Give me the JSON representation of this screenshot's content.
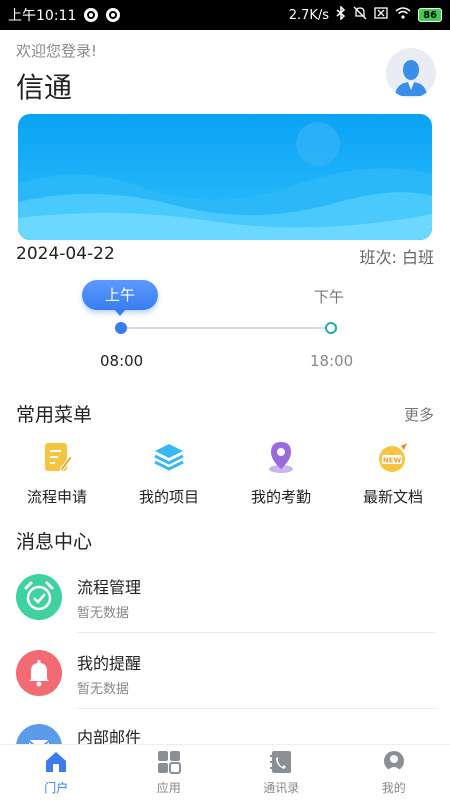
{
  "status_bar": {
    "time": "上午10:11",
    "network_speed": "2.7K/s",
    "battery": "86"
  },
  "header": {
    "welcome": "欢迎您登录!",
    "title": "信通"
  },
  "schedule": {
    "date": "2024-04-22",
    "shift_label": "班次:",
    "shift_value": "白班",
    "am_label": "上午",
    "pm_label": "下午",
    "am_time": "08:00",
    "pm_time": "18:00"
  },
  "common_menu": {
    "title": "常用菜单",
    "more": "更多",
    "items": [
      {
        "label": "流程申请",
        "icon": "document-edit-icon",
        "color": "#f5c542"
      },
      {
        "label": "我的项目",
        "icon": "layers-icon",
        "color": "#39b8ef"
      },
      {
        "label": "我的考勤",
        "icon": "location-pin-icon",
        "color": "#9b6bdc"
      },
      {
        "label": "最新文档",
        "icon": "new-badge-icon",
        "color": "#f5c542"
      }
    ]
  },
  "messages": {
    "title": "消息中心",
    "items": [
      {
        "title": "流程管理",
        "subtitle": "暂无数据",
        "icon": "alarm-clock-icon",
        "color": "#3fd1a0"
      },
      {
        "title": "我的提醒",
        "subtitle": "暂无数据",
        "icon": "bell-icon",
        "color": "#f26b73"
      },
      {
        "title": "内部邮件",
        "subtitle": "",
        "icon": "mail-icon",
        "color": "#5b9bea"
      }
    ]
  },
  "bottom_nav": {
    "items": [
      {
        "label": "门户",
        "icon": "home-icon",
        "active": true
      },
      {
        "label": "应用",
        "icon": "apps-grid-icon",
        "active": false
      },
      {
        "label": "通讯录",
        "icon": "contacts-icon",
        "active": false
      },
      {
        "label": "我的",
        "icon": "profile-icon",
        "active": false
      }
    ]
  },
  "colors": {
    "accent": "#3a7cf0",
    "banner_top": "#0aa2f5",
    "banner_bottom": "#62d6ff"
  }
}
